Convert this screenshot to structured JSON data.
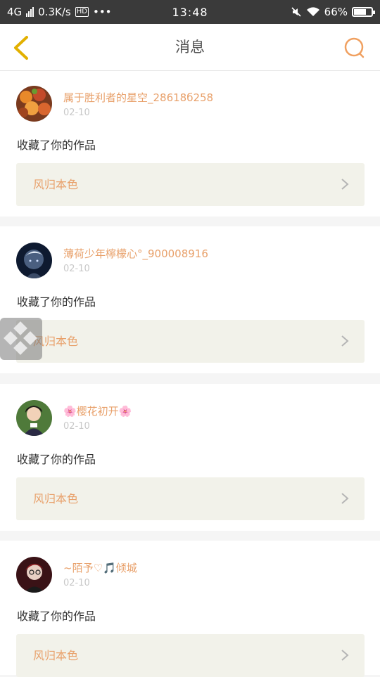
{
  "status_bar": {
    "network": "4G",
    "speed": "0.3K/s",
    "badge": "HD",
    "more": "•••",
    "time": "13:48",
    "battery": "66%"
  },
  "header": {
    "title": "消息"
  },
  "messages": [
    {
      "name": "属于胜利者的星空_28618б258",
      "date": "02-10",
      "action": "收藏了你的作品",
      "work": "风归本色"
    },
    {
      "name": "薄荷少年檸檬心°_900008916",
      "date": "02-10",
      "action": "收藏了你的作品",
      "work": "风归本色"
    },
    {
      "name": "🌸樱花初开🌸",
      "date": "02-10",
      "action": "收藏了你的作品",
      "work": "风归本色"
    },
    {
      "name": "~陌予♡🎵倾城",
      "date": "02-10",
      "action": "收藏了你的作品",
      "work": "风归本色"
    }
  ],
  "colors": {
    "accent": "#e8a06a",
    "back_icon": "#e2b000",
    "status_bar": "#3a3a3a",
    "work_box": "#f2f2ea"
  }
}
